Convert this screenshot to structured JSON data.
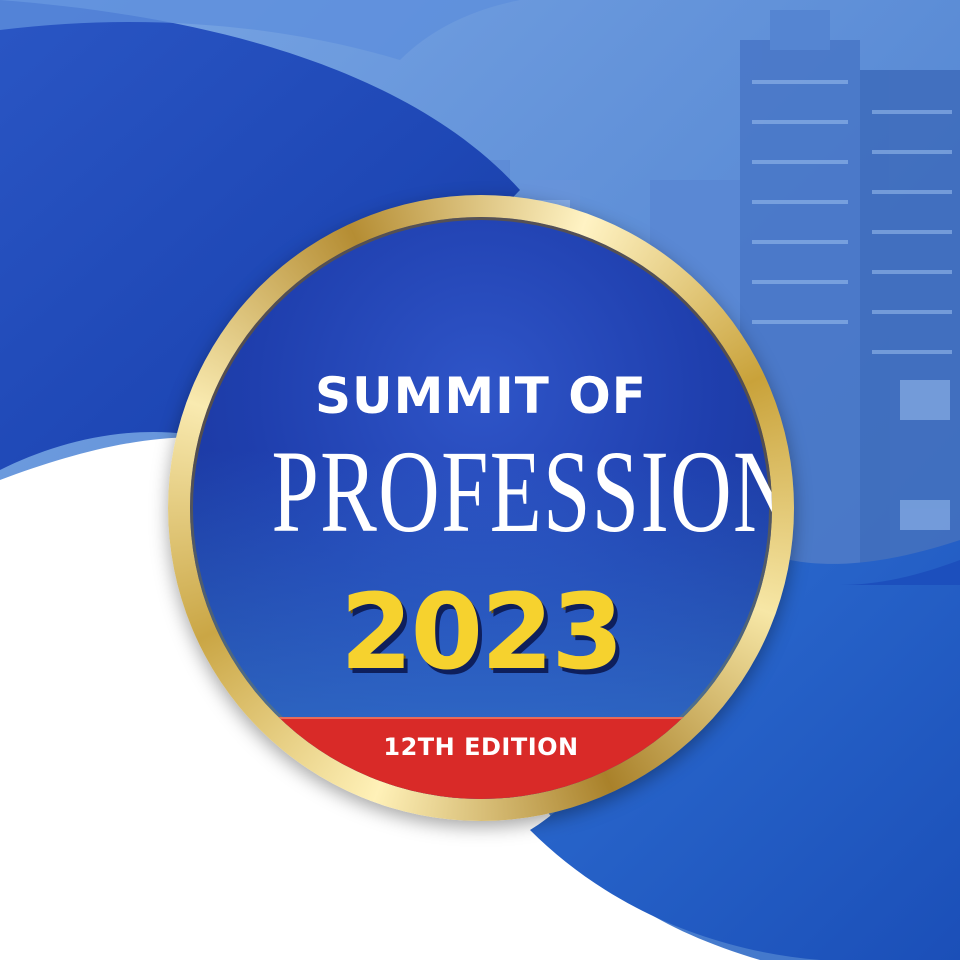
{
  "badge": {
    "line1": "SUMMIT OF",
    "line2": "PROFESSIONALS",
    "year": "2023",
    "edition": "12TH EDITION"
  },
  "colors": {
    "deep_blue": "#1a3aa8",
    "mid_blue": "#2f6fd0",
    "light_blue": "#6a98dc",
    "gold": "#d8b24a",
    "yellow_text": "#f6d22e",
    "red_band": "#d92a28",
    "white": "#ffffff"
  },
  "images": {
    "background_photo": "city-skyline-photo"
  }
}
